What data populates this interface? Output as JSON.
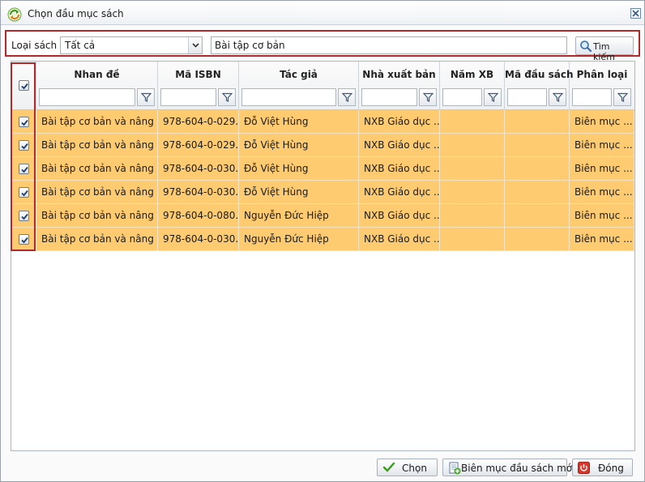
{
  "window": {
    "title": "Chọn đầu mục sách"
  },
  "filter": {
    "type_label": "Loại sách",
    "type_value": "Tất cả",
    "search_value": "Bài tập cơ bản",
    "search_button": "Tìm kiếm"
  },
  "grid": {
    "columns": [
      "Nhan đề",
      "Mã ISBN",
      "Tác giả",
      "Nhà xuất bản",
      "Năm XB",
      "Mã đầu sách",
      "Phân loại"
    ],
    "select_all_checked": true,
    "rows": [
      {
        "checked": true,
        "cells": [
          "Bài tập cơ bản và nâng ...",
          "978-604-0-029...",
          "Đỗ Việt Hùng",
          "NXB Giáo dục ...",
          "",
          "",
          "Biên mục ..."
        ]
      },
      {
        "checked": true,
        "cells": [
          "Bài tập cơ bản và nâng ...",
          "978-604-0-029...",
          "Đỗ Việt Hùng",
          "NXB Giáo dục ...",
          "",
          "",
          "Biên mục ..."
        ]
      },
      {
        "checked": true,
        "cells": [
          "Bài tập cơ bản và nâng ...",
          "978-604-0-030...",
          "Đỗ Việt Hùng",
          "NXB Giáo dục ...",
          "",
          "",
          "Biên mục ..."
        ]
      },
      {
        "checked": true,
        "cells": [
          "Bài tập cơ bản và nâng ...",
          "978-604-0-030...",
          "Đỗ Việt Hùng",
          "NXB Giáo dục ...",
          "",
          "",
          "Biên mục ..."
        ]
      },
      {
        "checked": true,
        "cells": [
          "Bài tập cơ bản và nâng ...",
          "978-604-0-080...",
          "Nguyễn Đức Hiệp",
          "NXB Giáo dục ...",
          "",
          "",
          "Biên mục ..."
        ]
      },
      {
        "checked": true,
        "cells": [
          "Bài tập cơ bản và nâng ...",
          "978-604-0-030...",
          "Nguyễn Đức Hiệp",
          "NXB Giáo dục ...",
          "",
          "",
          "Biên mục ..."
        ]
      }
    ]
  },
  "footer": {
    "choose_label": "Chọn",
    "new_catalog_label": "Biên mục đầu sách mới",
    "close_label": "Đóng"
  },
  "colors": {
    "row_highlight": "#ffcb70",
    "annotation_border": "#b02a2a"
  },
  "icons": [
    "refresh-app-icon",
    "close-icon",
    "chevron-down-icon",
    "search-icon",
    "filter-icon",
    "checkmark-icon",
    "add-document-icon",
    "power-icon"
  ]
}
